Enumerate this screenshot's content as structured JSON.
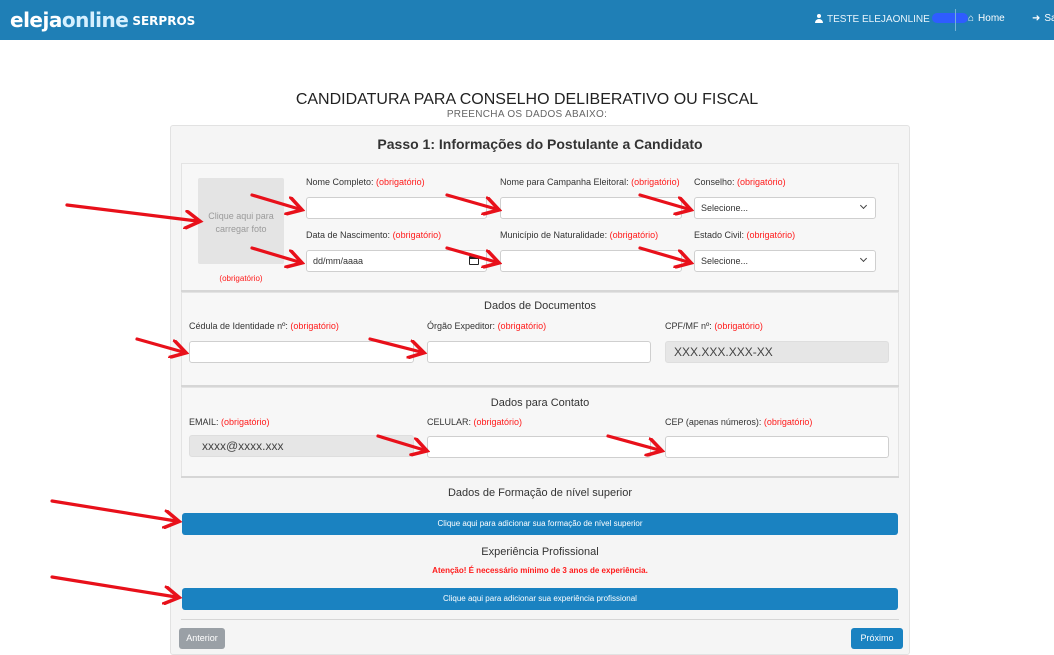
{
  "header": {
    "logo_main_a": "eleja",
    "logo_main_b": "online",
    "logo_sub": "SERPROS",
    "user_name": "TESTE ELEJAONLINE",
    "home_label": "Home",
    "logout_label": "Sa",
    "colors": {
      "bar": "#1f7fb6"
    }
  },
  "page": {
    "title": "CANDIDATURA PARA CONSELHO DELIBERATIVO OU FISCAL",
    "subtitle": "PREENCHA OS DADOS ABAIXO:"
  },
  "step": {
    "title": "Passo 1: Informações do Postulante a Candidato"
  },
  "required_text": "(obrigatório)",
  "personal": {
    "photo_label": "Clique aqui para carregar foto",
    "photo_req": "(obrigatório)",
    "full_name_label": "Nome Completo:",
    "campaign_name_label": "Nome para Campanha Eleitoral:",
    "council_label": "Conselho:",
    "council_value": "Selecione...",
    "birth_label": "Data de Nascimento:",
    "birth_placeholder": "dd/mm/aaaa",
    "city_label": "Município de Naturalidade:",
    "civil_label": "Estado Civil:",
    "civil_value": "Selecione..."
  },
  "documents": {
    "title": "Dados de Documentos",
    "id_label": "Cédula de Identidade nº:",
    "issuer_label": "Órgão Expeditor:",
    "cpf_label": "CPF/MF nº:",
    "cpf_value": "XXX.XXX.XXX-XX"
  },
  "contact": {
    "title": "Dados para Contato",
    "email_label": "EMAIL:",
    "email_value": "xxxx@xxxx.xxx",
    "phone_label": "CELULAR:",
    "cep_label": "CEP (apenas números):"
  },
  "education": {
    "title": "Dados de Formação de nível superior",
    "button": "Clique aqui para adicionar sua formação de nível superior"
  },
  "experience": {
    "title": "Experiência Profissional",
    "warning": "Atenção! É necessário mínimo de 3 anos de experiência.",
    "button": "Clique aqui para adicionar sua experiência profissional"
  },
  "footer": {
    "prev_label": "Anterior",
    "next_label": "Próximo"
  },
  "colors": {
    "primary": "#1a82c1",
    "required": "#ff1a1a",
    "annotation_arrow": "#e8101a"
  }
}
